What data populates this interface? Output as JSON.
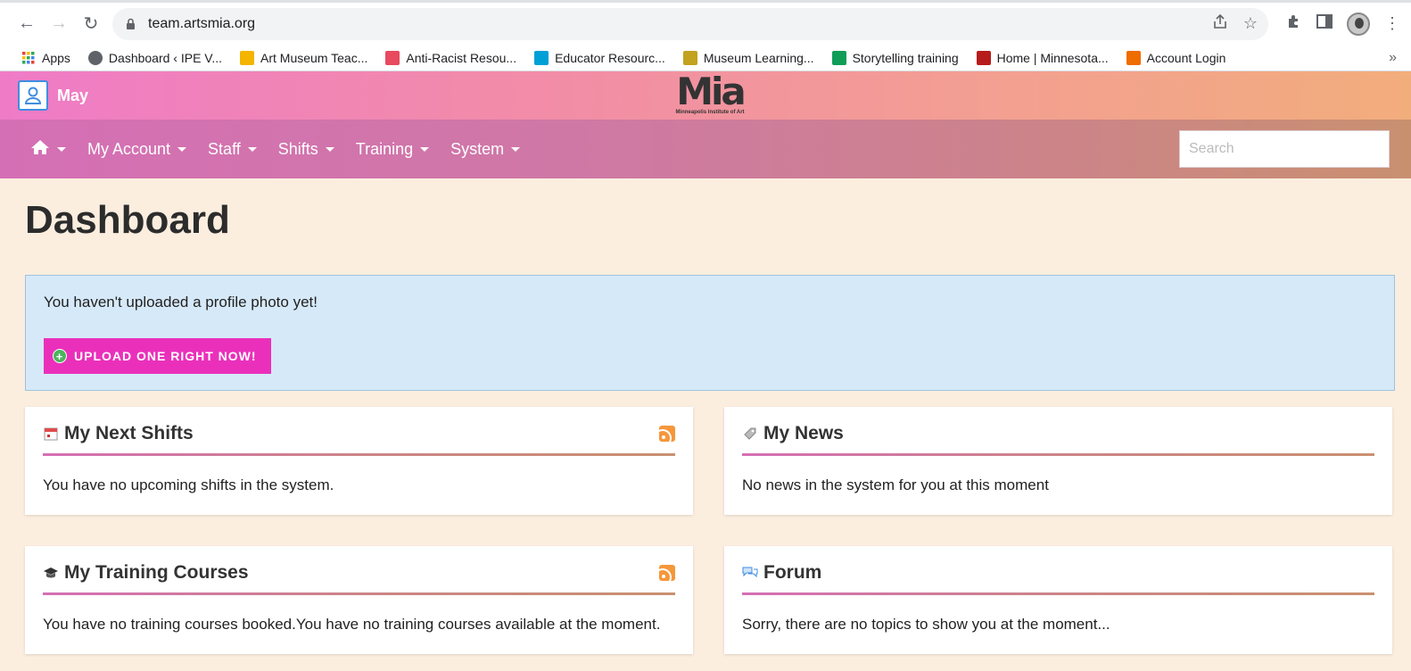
{
  "browser": {
    "url": "team.artsmia.org",
    "bookmarks": [
      {
        "label": "Apps",
        "icon": "apps-grid-icon",
        "color": "#4285f4"
      },
      {
        "label": "Dashboard ‹ IPE V...",
        "icon": "globe-icon",
        "color": "#5f6368"
      },
      {
        "label": "Art Museum Teac...",
        "icon": "folder-icon",
        "color": "#f4b400"
      },
      {
        "label": "Anti-Racist Resou...",
        "icon": "g-logo-icon",
        "color": "#e84a5f"
      },
      {
        "label": "Educator Resourc...",
        "icon": "bars-icon",
        "color": "#00a0d6"
      },
      {
        "label": "Museum Learning...",
        "icon": "cube-icon",
        "color": "#c2a21f"
      },
      {
        "label": "Storytelling training",
        "icon": "google-drive-icon",
        "color": "#0f9d58"
      },
      {
        "label": "Home | Minnesota...",
        "icon": "minnesota-icon",
        "color": "#b71c1c"
      },
      {
        "label": "Account Login",
        "icon": "flag-icon",
        "color": "#ef6c00"
      }
    ],
    "more": "»"
  },
  "header": {
    "user_name": "May",
    "logo_text": "Mia",
    "logo_sub": "Minneapolis Institute of Art"
  },
  "nav": {
    "items": [
      "My Account",
      "Staff",
      "Shifts",
      "Training",
      "System"
    ],
    "search_placeholder": "Search"
  },
  "page": {
    "title": "Dashboard",
    "alert": {
      "message": "You haven't uploaded a profile photo yet!",
      "button": "UPLOAD ONE RIGHT NOW!"
    }
  },
  "cards": {
    "next_shifts": {
      "title": "My Next Shifts",
      "body": "You have no upcoming shifts in the system."
    },
    "news": {
      "title": "My News",
      "body": "No news in the system for you at this moment"
    },
    "training": {
      "title": "My Training Courses",
      "body": "You have no training courses booked.You have no training courses available at the moment."
    },
    "forum": {
      "title": "Forum",
      "body": "Sorry, there are no topics to show you at the moment..."
    }
  },
  "colors": {
    "accent": "#ea30bb",
    "background": "#fbeedf",
    "alert_bg": "#d6e9f8"
  }
}
